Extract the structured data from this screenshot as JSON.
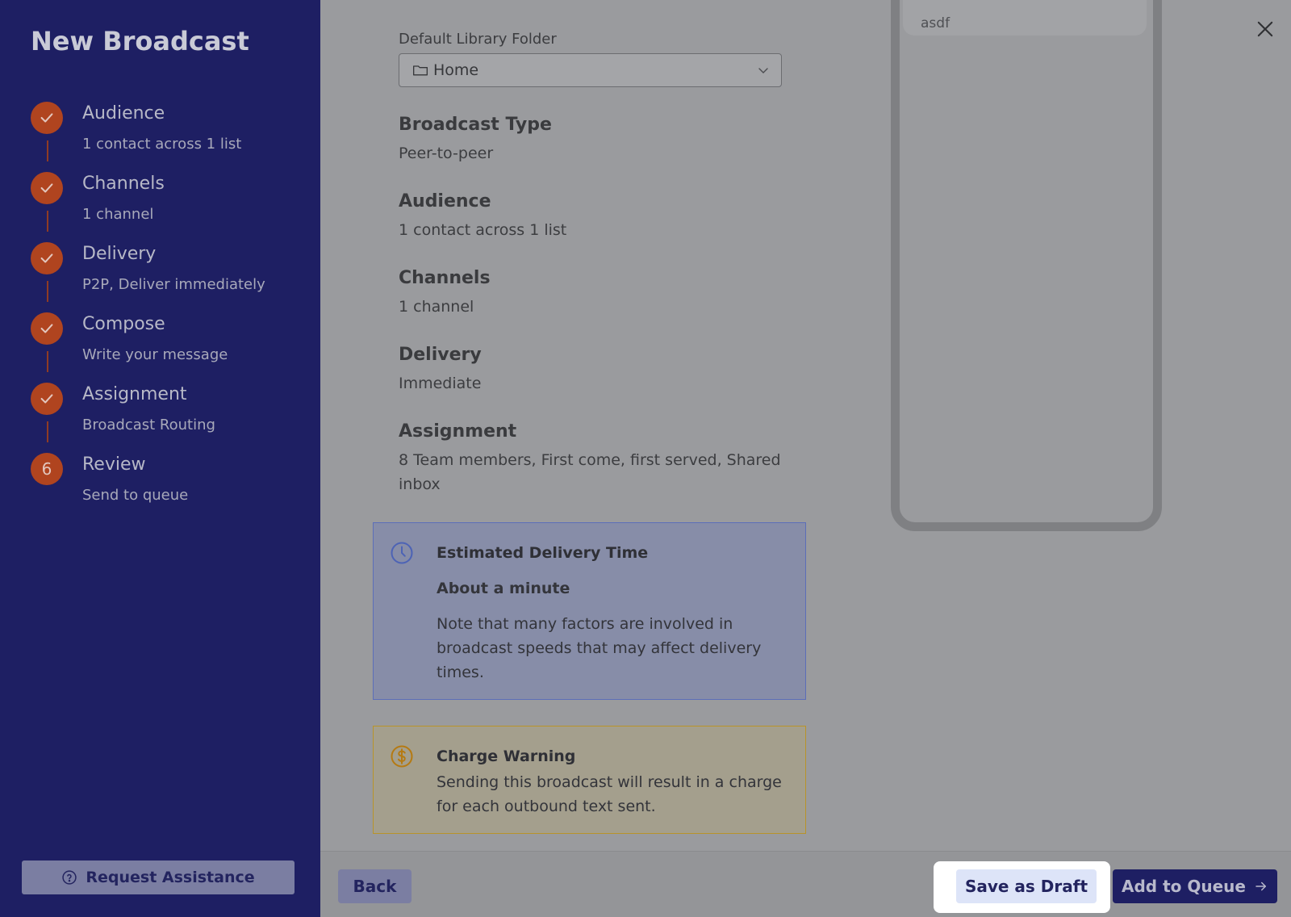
{
  "sidebar": {
    "title": "New Broadcast",
    "steps": [
      {
        "title": "Audience",
        "subtitle": "1 contact across 1 list",
        "status": "complete"
      },
      {
        "title": "Channels",
        "subtitle": "1 channel",
        "status": "complete"
      },
      {
        "title": "Delivery",
        "subtitle": "P2P, Deliver immediately",
        "status": "complete"
      },
      {
        "title": "Compose",
        "subtitle": "Write your message",
        "status": "complete"
      },
      {
        "title": "Assignment",
        "subtitle": "Broadcast Routing",
        "status": "complete"
      },
      {
        "title": "Review",
        "subtitle": "Send to queue",
        "status": "current",
        "number": "6"
      }
    ],
    "assist_label": "Request Assistance"
  },
  "main": {
    "folder_label": "Default Library Folder",
    "folder_value": "Home",
    "summary": [
      {
        "heading": "Broadcast Type",
        "value": "Peer-to-peer"
      },
      {
        "heading": "Audience",
        "value": "1 contact across 1 list"
      },
      {
        "heading": "Channels",
        "value": "1 channel"
      },
      {
        "heading": "Delivery",
        "value": "Immediate"
      },
      {
        "heading": "Assignment",
        "value": "8 Team members, First come, first served, Shared inbox"
      }
    ],
    "estimate": {
      "title": "Estimated Delivery Time",
      "value": "About a minute",
      "note": "Note that many factors are involved in broadcast speeds that may affect delivery times."
    },
    "charge": {
      "title": "Charge Warning",
      "note": "Sending this broadcast will result in a charge for each outbound text sent."
    },
    "preview": {
      "message": "asdf"
    }
  },
  "footer": {
    "back_label": "Back",
    "draft_label": "Save as Draft",
    "queue_label": "Add to Queue"
  },
  "colors": {
    "sidebar_bg": "#1e1f63",
    "step_accent": "#b0441f",
    "primary_button": "#1e1f63",
    "highlight": "#ffffff"
  },
  "icons": {
    "close": "close-icon",
    "folder": "folder-icon",
    "chevron": "chevron-down-icon",
    "clock": "clock-icon",
    "dollar": "dollar-icon",
    "help": "help-circle-icon",
    "arrow": "arrow-right-icon",
    "check": "check-icon"
  }
}
